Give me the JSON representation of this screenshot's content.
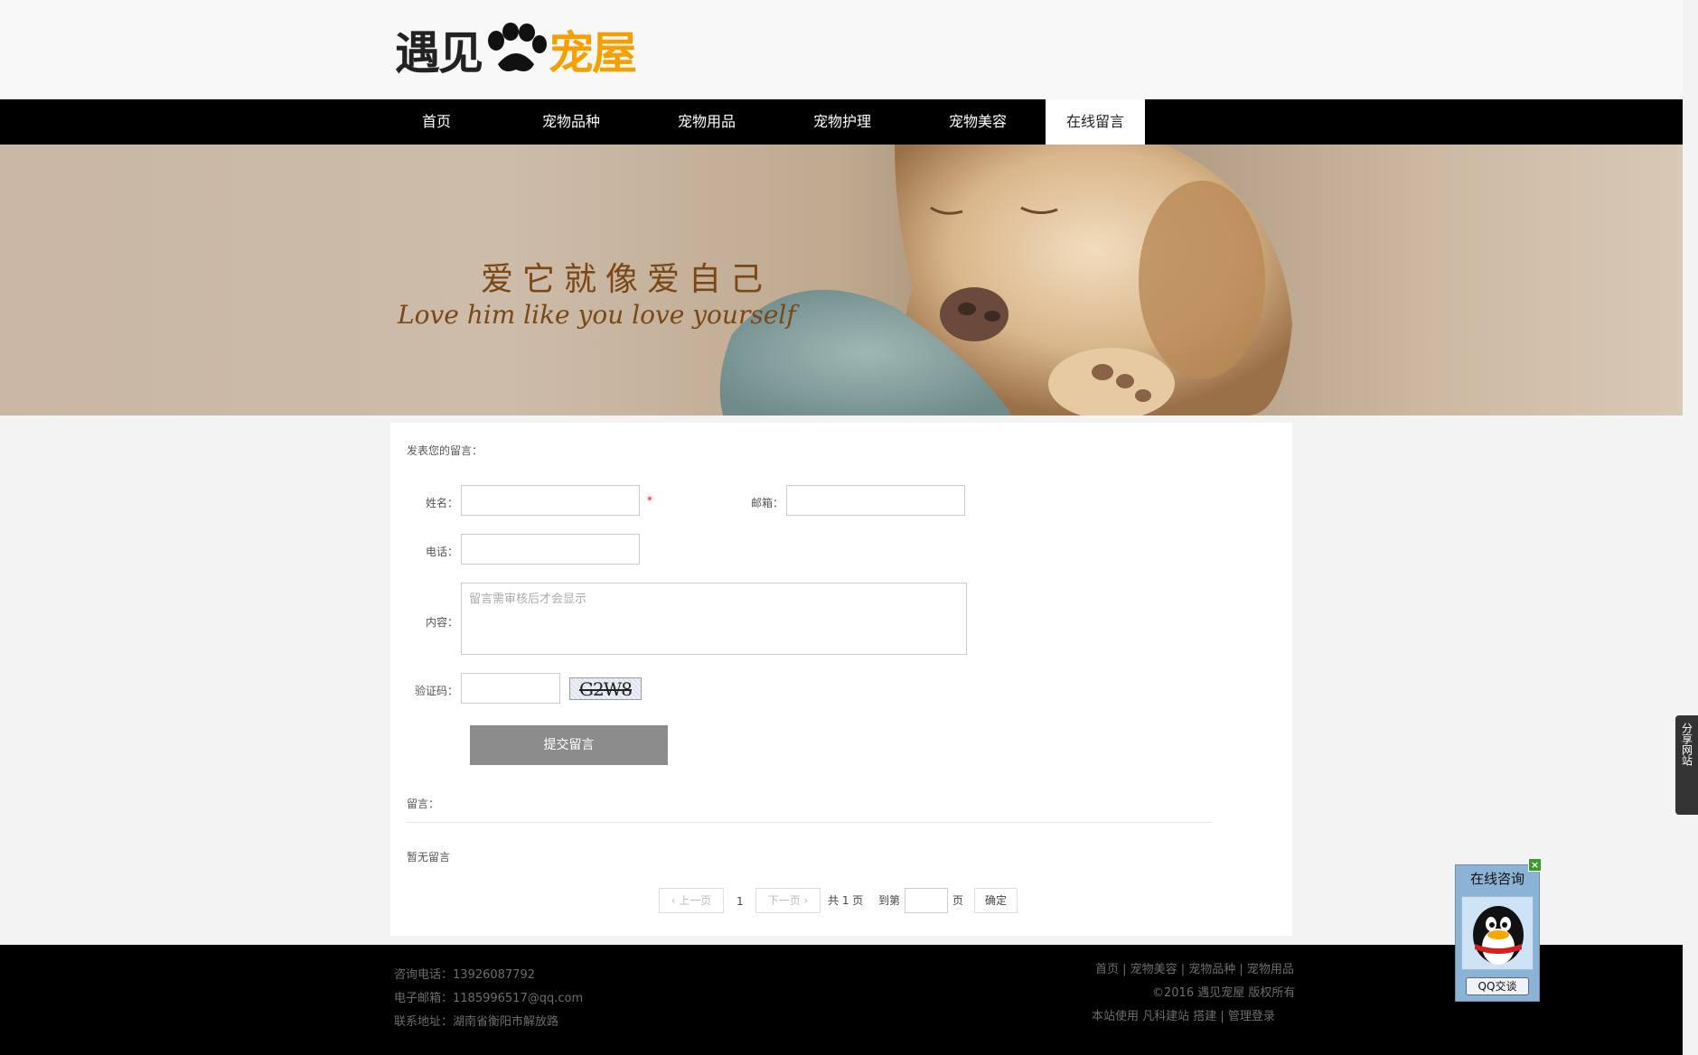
{
  "logo": {
    "text_a": "遇见",
    "text_b": "宠屋"
  },
  "nav": {
    "items": [
      "首页",
      "宠物品种",
      "宠物用品",
      "宠物护理",
      "宠物美容",
      "在线留言"
    ]
  },
  "banner": {
    "slogan_cn": "爱它就像爱自己",
    "slogan_en": "Love him like you love yourself"
  },
  "form": {
    "heading": "发表您的留言：",
    "name_label": "姓名：",
    "required_mark": "*",
    "email_label": "邮箱：",
    "phone_label": "电话：",
    "content_label": "内容：",
    "content_placeholder": "留言需审核后才会显示",
    "captcha_label": "验证码：",
    "captcha_text": "G2W8",
    "submit_label": "提交留言"
  },
  "messages": {
    "heading": "留言：",
    "empty_text": "暂无留言"
  },
  "pagination": {
    "prev_label": "‹ 上一页",
    "current_page": "1",
    "next_label": "下一页 ›",
    "total_text": "共 1 页",
    "goto_label": "到第",
    "page_suffix": "页",
    "confirm_label": "确定"
  },
  "footer": {
    "phone": "咨询电话：13926087792",
    "email": "电子邮箱：1185996517@qq.com",
    "address": "联系地址：湖南省衡阳市解放路",
    "links": "首页 | 宠物美容 | 宠物品种 | 宠物用品",
    "copyright": "©2016 遇见宠屋 版权所有",
    "powered": "本站使用 凡科建站 搭建 | 管理登录"
  },
  "share_widget": {
    "label": "分享网站"
  },
  "qq_widget": {
    "title": "在线咨询",
    "button": "QQ交谈",
    "close": "×"
  }
}
